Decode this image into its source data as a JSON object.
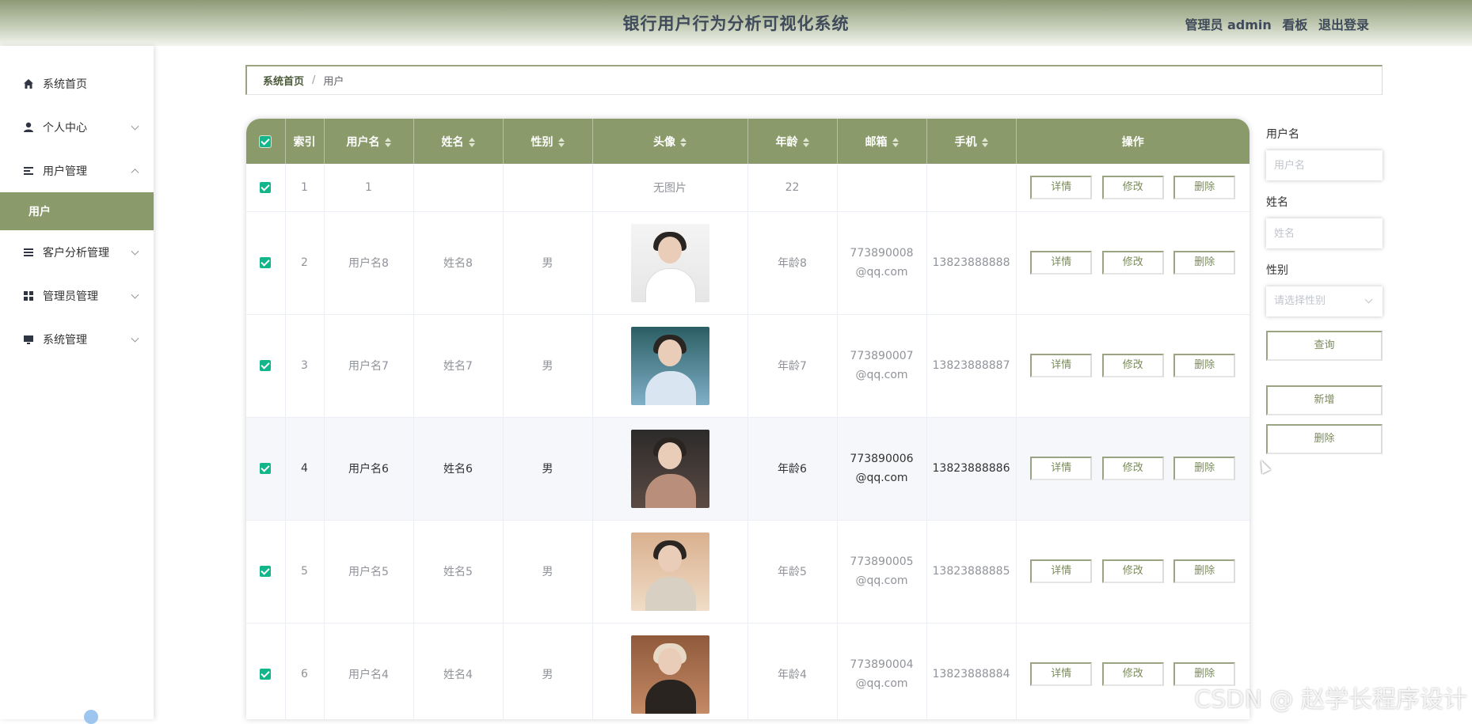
{
  "header": {
    "title": "银行用户行为分析可视化系统",
    "role": "管理员 admin",
    "board": "看板",
    "logout": "退出登录"
  },
  "sidebar": {
    "items": [
      {
        "label": "系统首页",
        "icon": "home-icon",
        "expandable": false
      },
      {
        "label": "个人中心",
        "icon": "person-icon",
        "expandable": true,
        "expanded": false
      },
      {
        "label": "用户管理",
        "icon": "list-icon",
        "expandable": true,
        "expanded": true,
        "children": [
          "用户"
        ]
      },
      {
        "label": "客户分析管理",
        "icon": "list-icon",
        "expandable": true,
        "expanded": false
      },
      {
        "label": "管理员管理",
        "icon": "grid-icon",
        "expandable": true,
        "expanded": false
      },
      {
        "label": "系统管理",
        "icon": "monitor-icon",
        "expandable": true,
        "expanded": false
      }
    ],
    "active_sub": "用户"
  },
  "breadcrumb": {
    "home": "系统首页",
    "separator": "/",
    "current": "用户"
  },
  "table": {
    "columns": [
      "索引",
      "用户名",
      "姓名",
      "性别",
      "头像",
      "年龄",
      "邮箱",
      "手机",
      "操作"
    ],
    "rows": [
      {
        "index": "1",
        "username": "1",
        "name": "",
        "gender": "",
        "avatar": "无图片",
        "age": "22",
        "email": "",
        "phone": "",
        "checked": true
      },
      {
        "index": "2",
        "username": "用户名8",
        "name": "姓名8",
        "gender": "男",
        "avatar": "photo",
        "age": "年龄8",
        "email": "773890008@qq.com",
        "phone": "13823888888",
        "checked": true
      },
      {
        "index": "3",
        "username": "用户名7",
        "name": "姓名7",
        "gender": "男",
        "avatar": "photo",
        "age": "年龄7",
        "email": "773890007@qq.com",
        "phone": "13823888887",
        "checked": true
      },
      {
        "index": "4",
        "username": "用户名6",
        "name": "姓名6",
        "gender": "男",
        "avatar": "photo",
        "age": "年龄6",
        "email": "773890006@qq.com",
        "phone": "13823888886",
        "checked": true
      },
      {
        "index": "5",
        "username": "用户名5",
        "name": "姓名5",
        "gender": "男",
        "avatar": "photo",
        "age": "年龄5",
        "email": "773890005@qq.com",
        "phone": "13823888885",
        "checked": true
      },
      {
        "index": "6",
        "username": "用户名4",
        "name": "姓名4",
        "gender": "男",
        "avatar": "photo",
        "age": "年龄4",
        "email": "773890004@qq.com",
        "phone": "13823888884",
        "checked": true
      }
    ],
    "actions": {
      "detail": "详情",
      "edit": "修改",
      "delete": "删除"
    }
  },
  "search": {
    "username_label": "用户名",
    "username_placeholder": "用户名",
    "name_label": "姓名",
    "name_placeholder": "姓名",
    "gender_label": "性别",
    "gender_placeholder": "请选择性别",
    "query": "查询",
    "add": "新增",
    "delete": "删除"
  },
  "watermark": "CSDN @ 赵学长程序设计",
  "colors": {
    "accent": "#8a9a6a",
    "checkbox": "#13b58a",
    "header_dark": "#3f4a5a"
  }
}
